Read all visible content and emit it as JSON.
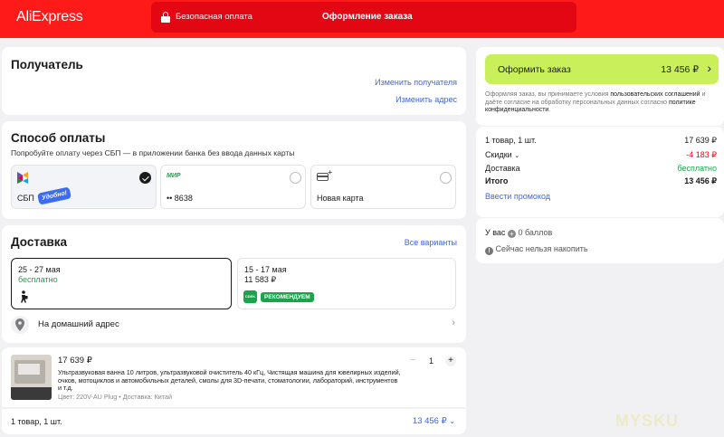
{
  "header": {
    "logo": "AliExpress",
    "secure_payment": "Безопасная оплата",
    "title": "Оформление заказа"
  },
  "recipient": {
    "title": "Получатель",
    "change_recipient": "Изменить получателя",
    "change_address": "Изменить адрес"
  },
  "payment": {
    "title": "Способ оплаты",
    "subtitle": "Попробуйте оплату через СБП — в приложении банка без ввода данных карты",
    "options": [
      {
        "label": "СБП",
        "badge": "Удобно!",
        "selected": true
      },
      {
        "logo": "МИР",
        "label": "•• 8638",
        "selected": false
      },
      {
        "label": "Новая карта",
        "selected": false
      }
    ]
  },
  "delivery": {
    "title": "Доставка",
    "all_variants": "Все варианты",
    "options": [
      {
        "dates": "25 - 27 мая",
        "price": "бесплатно",
        "selected": true
      },
      {
        "dates": "15 - 17 мая",
        "price": "11 583 ₽",
        "badge": "РЕКОМЕНДУЕМ",
        "carrier": "CDEK",
        "selected": false
      }
    ],
    "address_label": "На домашний адрес"
  },
  "product": {
    "price": "17 639 ₽",
    "description": "Ультразвуковая ванна 10 литров, ультразвуковой очиститель 40 кГц, Чистящая машина для ювелирных изделий, очков, мотоциклов и автомобильных деталей, смолы для 3D-печати, стоматологии, лабораторий, инструментов и т.д.",
    "meta": "Цвет: 220V-AU Plug • Доставка: Китай",
    "qty": "1",
    "minus": "−",
    "plus": "+"
  },
  "footer": {
    "count": "1 товар, 1 шт.",
    "total": "13 456 ₽"
  },
  "summary": {
    "button_label": "Оформить заказ",
    "button_price": "13 456 ₽",
    "legal_1": "Оформляя заказ, вы принимаете условия ",
    "legal_link_1": "пользовательских соглашений",
    "legal_2": " и даёте согласие на обработку персональных данных согласно ",
    "legal_link_2": "политике конфиденциальности",
    "legal_3": ".",
    "rows": [
      {
        "label": "1 товар, 1 шт.",
        "value": "17 639 ₽"
      },
      {
        "label": "Скидки",
        "value": "-4 183 ₽"
      },
      {
        "label": "Доставка",
        "value": "бесплатно"
      },
      {
        "label": "Итого",
        "value": "13 456 ₽"
      }
    ],
    "promo": "Ввести промокод"
  },
  "points": {
    "balance_prefix": "У вас",
    "balance_value": "0 баллов",
    "info": "Сейчас нельзя накопить"
  },
  "watermark": "MYSKU"
}
